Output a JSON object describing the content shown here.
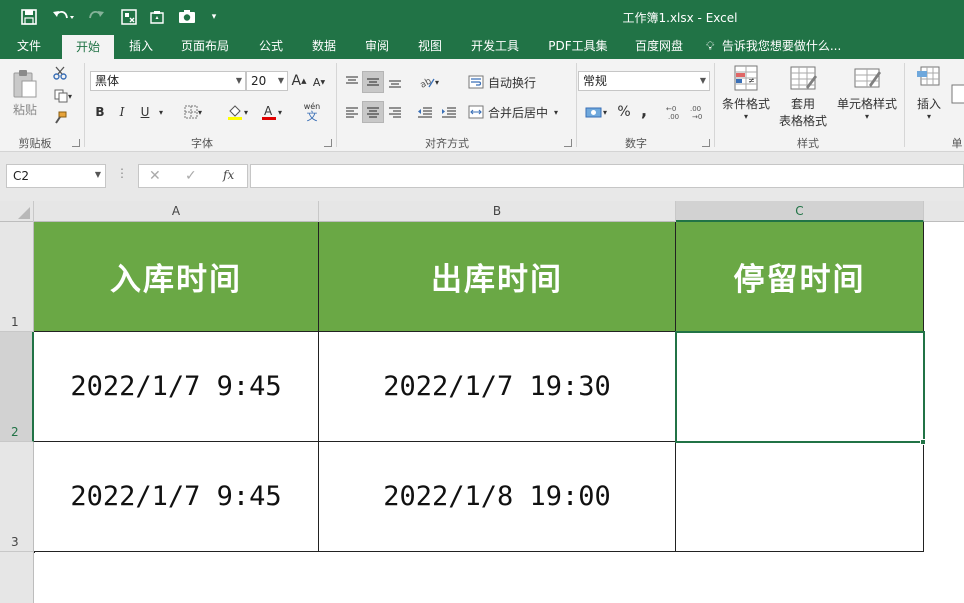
{
  "window": {
    "title": "工作簿1.xlsx - Excel"
  },
  "tabs": [
    "文件",
    "开始",
    "插入",
    "页面布局",
    "公式",
    "数据",
    "审阅",
    "视图",
    "开发工具",
    "PDF工具集",
    "百度网盘"
  ],
  "tell_me": "告诉我您想要做什么...",
  "ribbon": {
    "clipboard": {
      "paste": "粘贴",
      "group": "剪贴板"
    },
    "font": {
      "name": "黑体",
      "size": "20",
      "bold": "B",
      "italic": "I",
      "underline": "U",
      "grow": "A",
      "shrink": "A",
      "group": "字体",
      "phonetic_top": "wén",
      "phonetic_bottom": "文"
    },
    "alignment": {
      "wrap": "自动换行",
      "merge": "合并后居中",
      "group": "对齐方式"
    },
    "number": {
      "format": "常规",
      "percent": "%",
      "comma": ",",
      "group": "数字"
    },
    "styles": {
      "conditional": "条件格式",
      "table_line1": "套用",
      "table_line2": "表格格式",
      "cell": "单元格样式",
      "group": "样式"
    },
    "cells": {
      "insert": "插入",
      "group_partial": "单"
    }
  },
  "formula_bar": {
    "name_box": "C2",
    "fx": "fx",
    "value": ""
  },
  "columns": [
    "A",
    "B",
    "C"
  ],
  "rows": [
    "1",
    "2",
    "3"
  ],
  "sheet": {
    "headers": [
      "入库时间",
      "出库时间",
      "停留时间"
    ],
    "data": [
      [
        "2022/1/7 9:45",
        "2022/1/7 19:30",
        ""
      ],
      [
        "2022/1/7 9:45",
        "2022/1/8 19:00",
        ""
      ]
    ]
  },
  "colors": {
    "excel_green": "#217346",
    "header_fill": "#6aa845"
  }
}
